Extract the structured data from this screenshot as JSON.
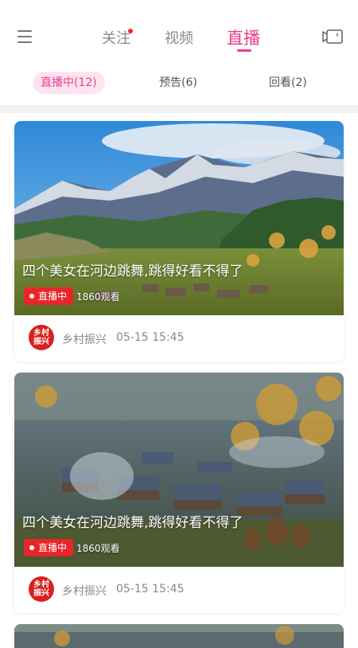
{
  "header": {
    "tabs": [
      {
        "label": "关注",
        "has_dot": true
      },
      {
        "label": "视频"
      },
      {
        "label": "直播",
        "active": true
      }
    ],
    "menu_icon": "hamburger-menu-icon",
    "camera_icon": "video-camera-icon"
  },
  "subtabs": [
    {
      "label": "直播中(12)",
      "active": true
    },
    {
      "label": "预告(6)"
    },
    {
      "label": "回看(2)"
    }
  ],
  "colors": {
    "accent": "#ee3b8f",
    "live_badge": "#e8262a"
  },
  "cards": [
    {
      "title": "四个美女在河边跳舞,跳得好看不得了",
      "badge": "直播中",
      "viewers": "1860观看",
      "avatar_text": "乡村振兴",
      "author": "乡村振兴",
      "time": "05-15 15:45"
    },
    {
      "title": "四个美女在河边跳舞,跳得好看不得了",
      "badge": "直播中",
      "viewers": "1860观看",
      "avatar_text": "乡村振兴",
      "author": "乡村振兴",
      "time": "05-15 15:45"
    }
  ]
}
